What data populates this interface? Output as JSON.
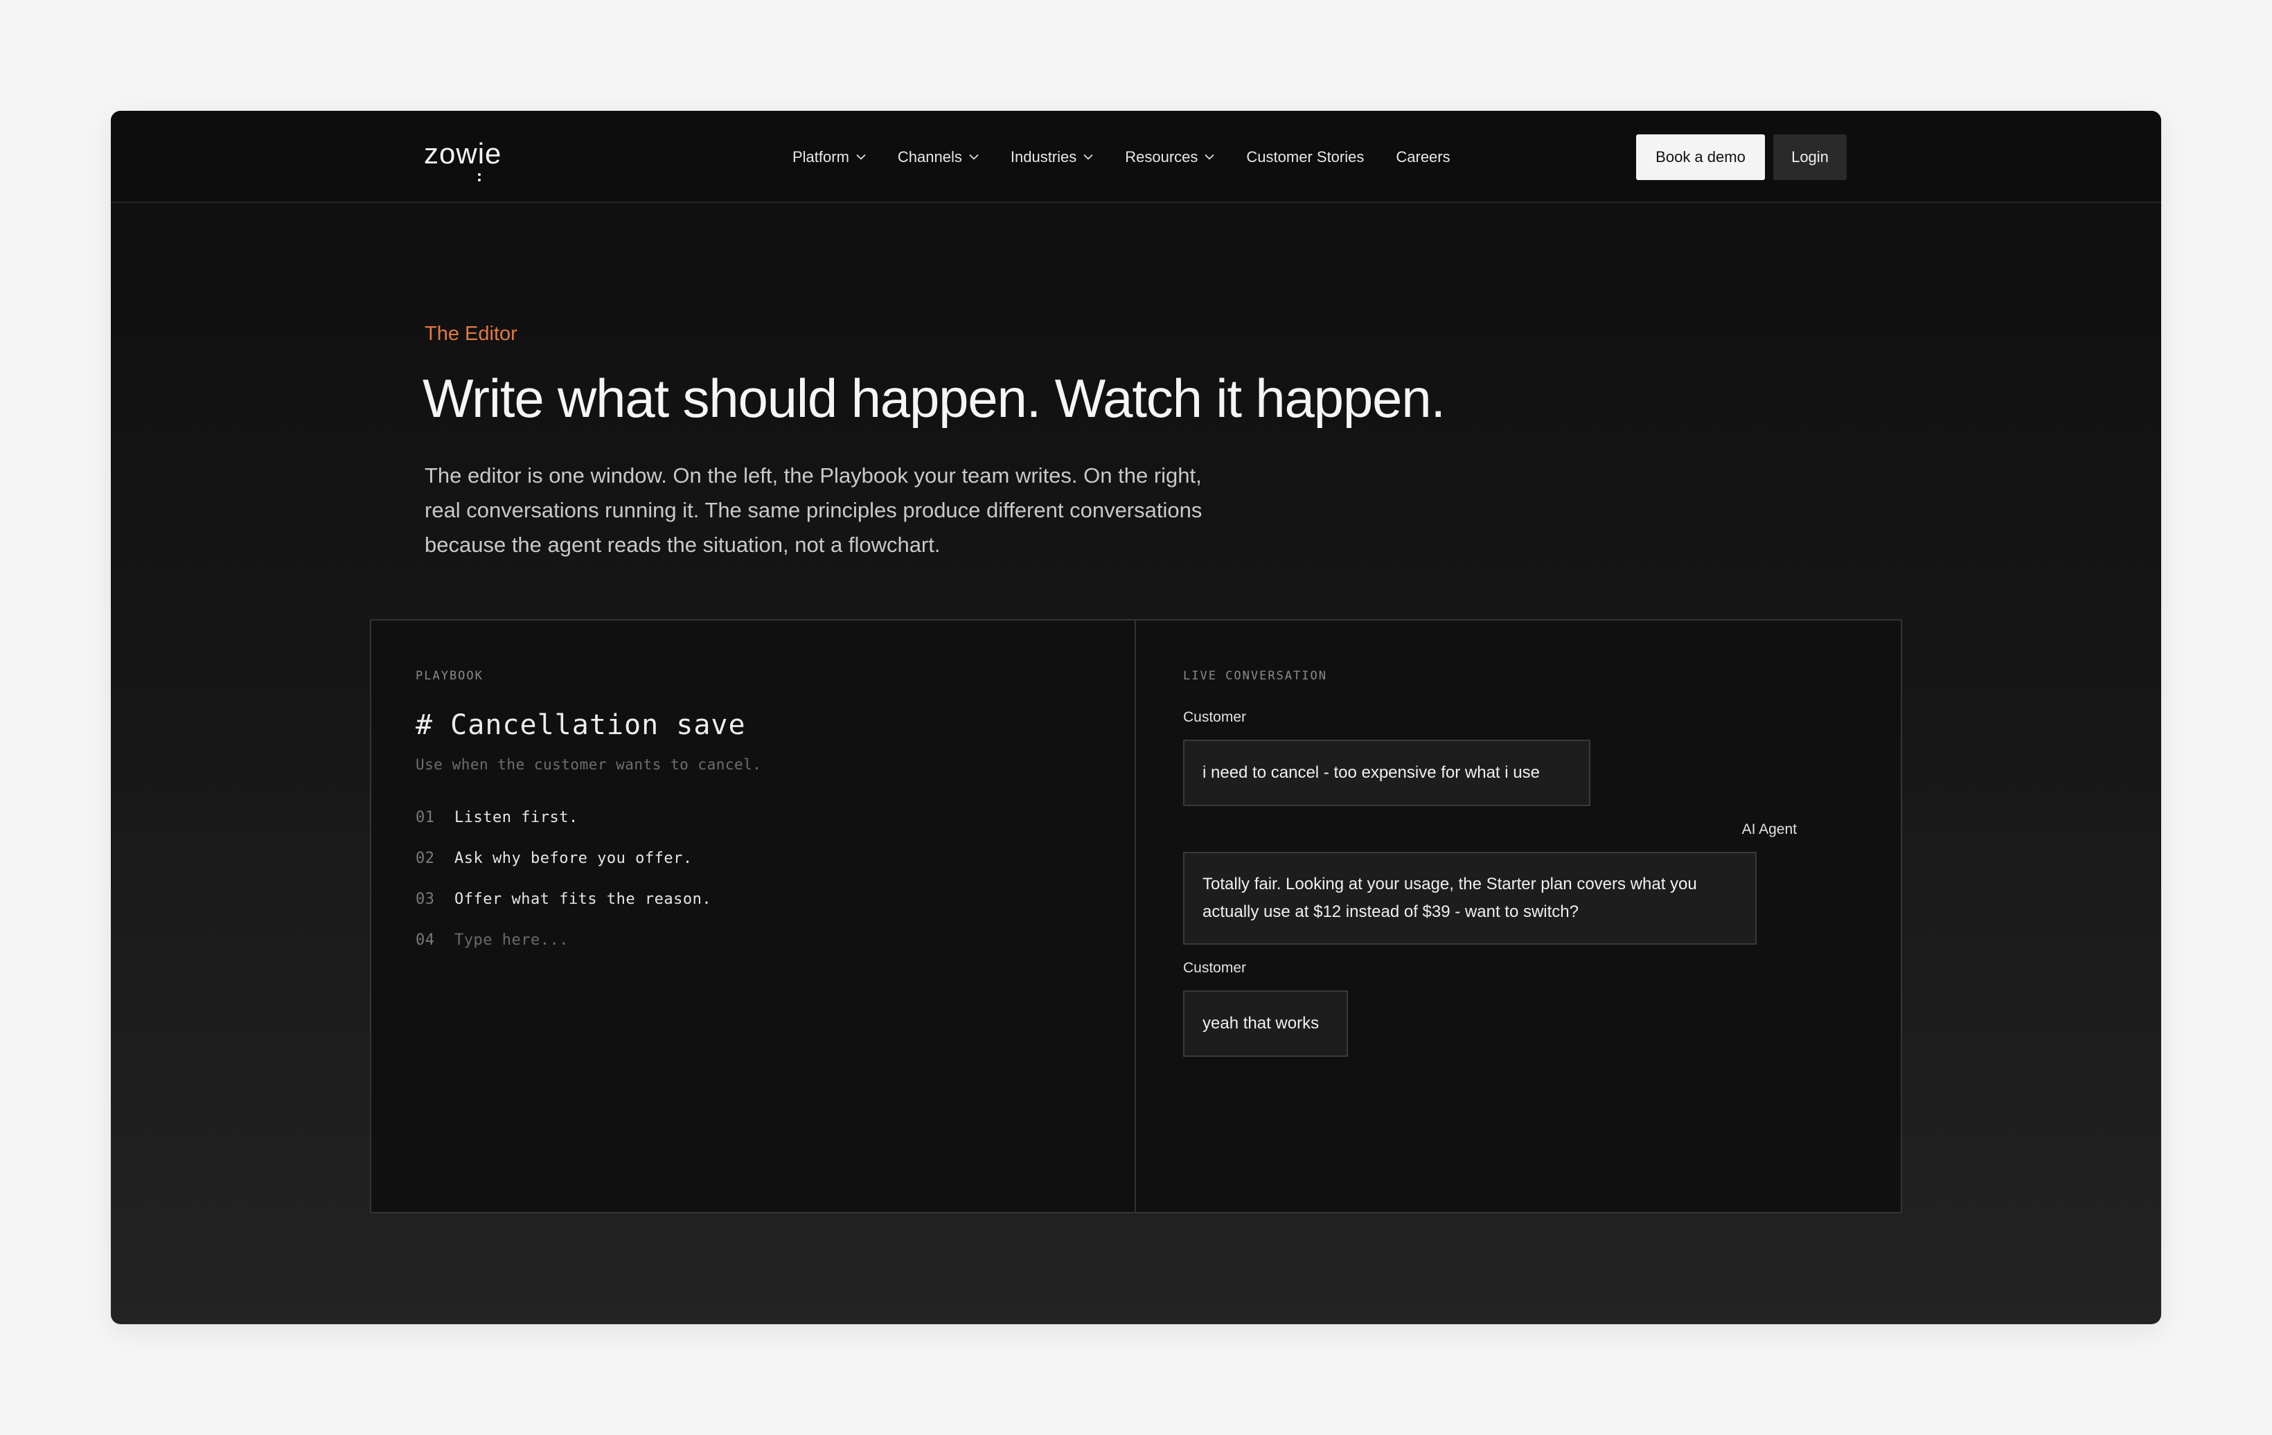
{
  "nav": {
    "logo": "zowie",
    "items": [
      {
        "label": "Platform",
        "dropdown": true
      },
      {
        "label": "Channels",
        "dropdown": true
      },
      {
        "label": "Industries",
        "dropdown": true
      },
      {
        "label": "Resources",
        "dropdown": true
      },
      {
        "label": "Customer Stories",
        "dropdown": false
      },
      {
        "label": "Careers",
        "dropdown": false
      }
    ],
    "demo_label": "Book a demo",
    "login_label": "Login"
  },
  "hero": {
    "eyebrow": "The Editor",
    "headline": "Write what should happen. Watch it happen.",
    "lede": "The editor is one window. On the left, the Playbook your team writes. On the right, real conversations running it. The same principles produce different conversations because the agent reads the situation, not a flowchart."
  },
  "playbook": {
    "label": "PLAYBOOK",
    "title": "# Cancellation save",
    "subtitle": "Use when the customer wants to cancel.",
    "lines": [
      {
        "num": "01",
        "text": "Listen first."
      },
      {
        "num": "02",
        "text": "Ask why before you offer."
      },
      {
        "num": "03",
        "text": "Offer what fits the reason."
      },
      {
        "num": "04",
        "text": "Type here..."
      }
    ]
  },
  "conversation": {
    "label": "LIVE CONVERSATION",
    "messages": [
      {
        "speaker": "Customer",
        "text": "i need to cancel - too expensive for what i use"
      },
      {
        "speaker": "AI Agent",
        "text": "Totally fair. Looking at your usage, the Starter plan covers what you actually use at $12 instead of $39 - want to switch?"
      },
      {
        "speaker": "Customer",
        "text": "yeah that works"
      }
    ]
  },
  "colors": {
    "accent": "#e27a3f",
    "background": "#f5f5f5",
    "frame": "#111111"
  }
}
